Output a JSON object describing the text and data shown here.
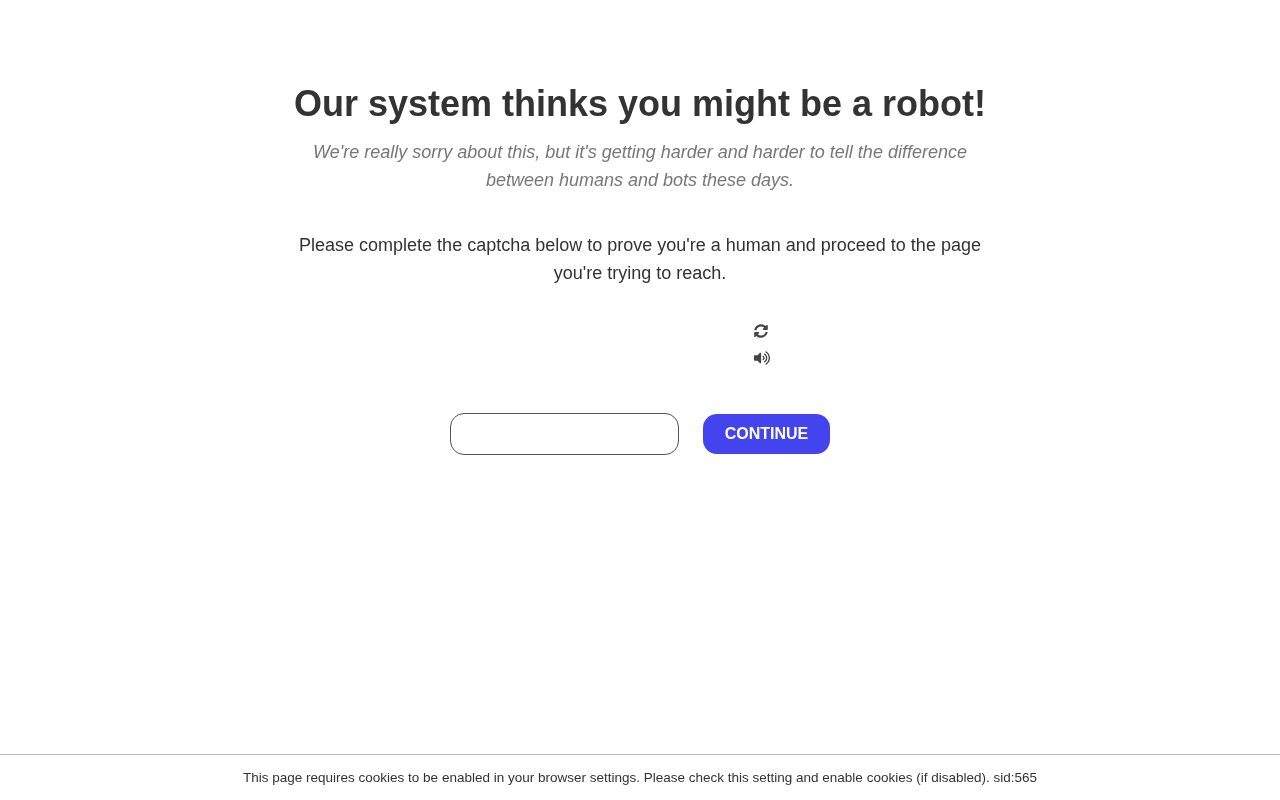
{
  "heading": "Our system thinks you might be a robot!",
  "subtitle": "We're really sorry about this, but it's getting harder and harder to tell the difference between humans and bots these days.",
  "instructions": "Please complete the captcha below to prove you're a human and proceed to the page you're trying to reach.",
  "captcha": {
    "controls": [
      {
        "kind": "refresh"
      },
      {
        "kind": "audio"
      }
    ]
  },
  "continue_button": {
    "label": "CONTINUE"
  },
  "footer": {
    "notice": "This page requires cookies to be enabled in your browser settings. Please check this setting and enable cookies (if disabled). sid:565"
  }
}
